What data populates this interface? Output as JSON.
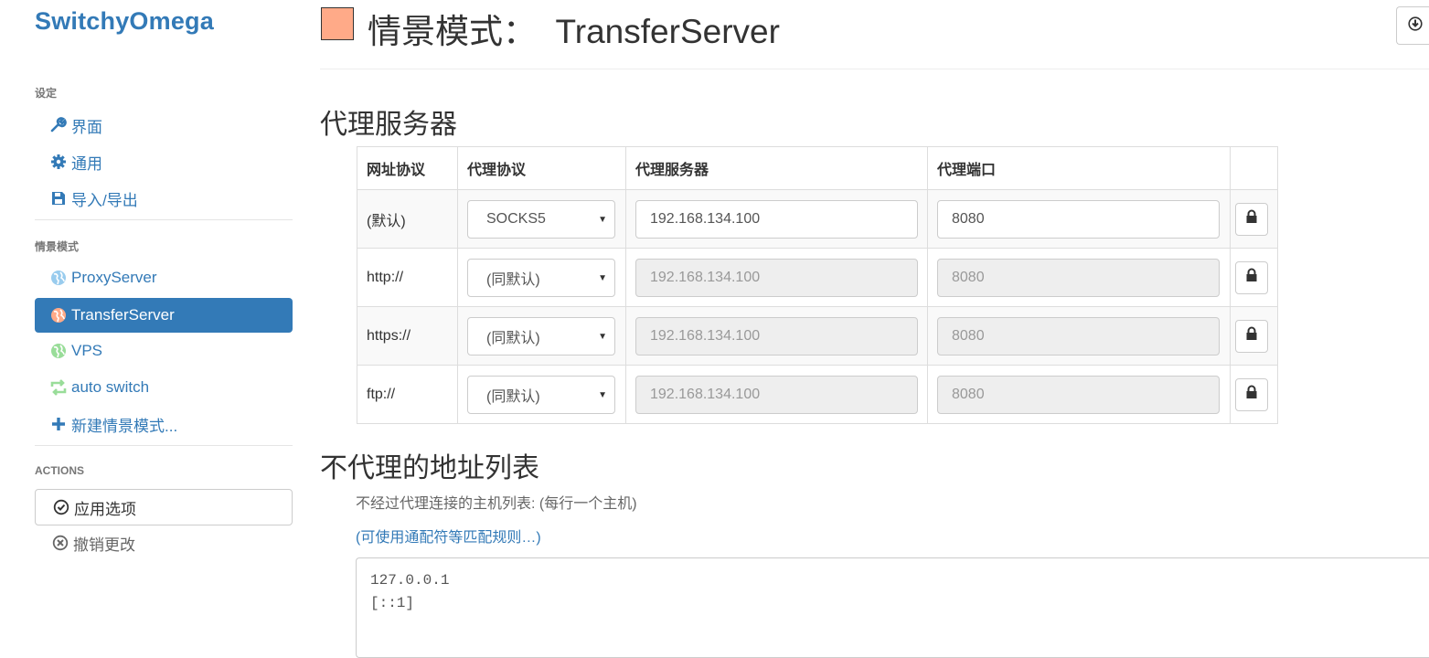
{
  "app": {
    "brand": "SwitchyOmega"
  },
  "sidebar": {
    "settings_label": "设定",
    "settings_items": [
      {
        "label": "界面",
        "icon": "wrench-icon"
      },
      {
        "label": "通用",
        "icon": "gear-icon"
      },
      {
        "label": "导入/导出",
        "icon": "floppy-icon"
      }
    ],
    "profiles_label": "情景模式",
    "profiles": [
      {
        "label": "ProxyServer",
        "icon": "globe-icon",
        "color": "#99ccee",
        "active": false
      },
      {
        "label": "TransferServer",
        "icon": "globe-icon",
        "color": "#ffaa88",
        "active": true
      },
      {
        "label": "VPS",
        "icon": "globe-icon",
        "color": "#99dd99",
        "active": false
      },
      {
        "label": "auto switch",
        "icon": "switch-icon",
        "color": "#99dd99",
        "active": false
      },
      {
        "label": "新建情景模式...",
        "icon": "plus-icon",
        "color": "#337ab7",
        "active": false
      }
    ],
    "actions_label": "ACTIONS",
    "apply_label": "应用选项",
    "discard_label": "撤销更改"
  },
  "header": {
    "title": "情景模式：  TransferServer",
    "profile_color": "#ffaa88"
  },
  "proxy_section": {
    "heading": "代理服务器",
    "columns": [
      "网址协议",
      "代理协议",
      "代理服务器",
      "代理端口"
    ],
    "rows": [
      {
        "scheme": "(默认)",
        "protocol": "SOCKS5",
        "host": "192.168.134.100",
        "port": "8080",
        "disabled": false
      },
      {
        "scheme": "http://",
        "protocol": "(同默认)",
        "host": "192.168.134.100",
        "port": "8080",
        "disabled": true
      },
      {
        "scheme": "https://",
        "protocol": "(同默认)",
        "host": "192.168.134.100",
        "port": "8080",
        "disabled": true
      },
      {
        "scheme": "ftp://",
        "protocol": "(同默认)",
        "host": "192.168.134.100",
        "port": "8080",
        "disabled": true
      }
    ]
  },
  "bypass_section": {
    "heading": "不代理的地址列表",
    "description": "不经过代理连接的主机列表: (每行一个主机)",
    "help_link": "(可使用通配符等匹配规则…)",
    "entries": [
      "127.0.0.1",
      "[::1]"
    ]
  }
}
